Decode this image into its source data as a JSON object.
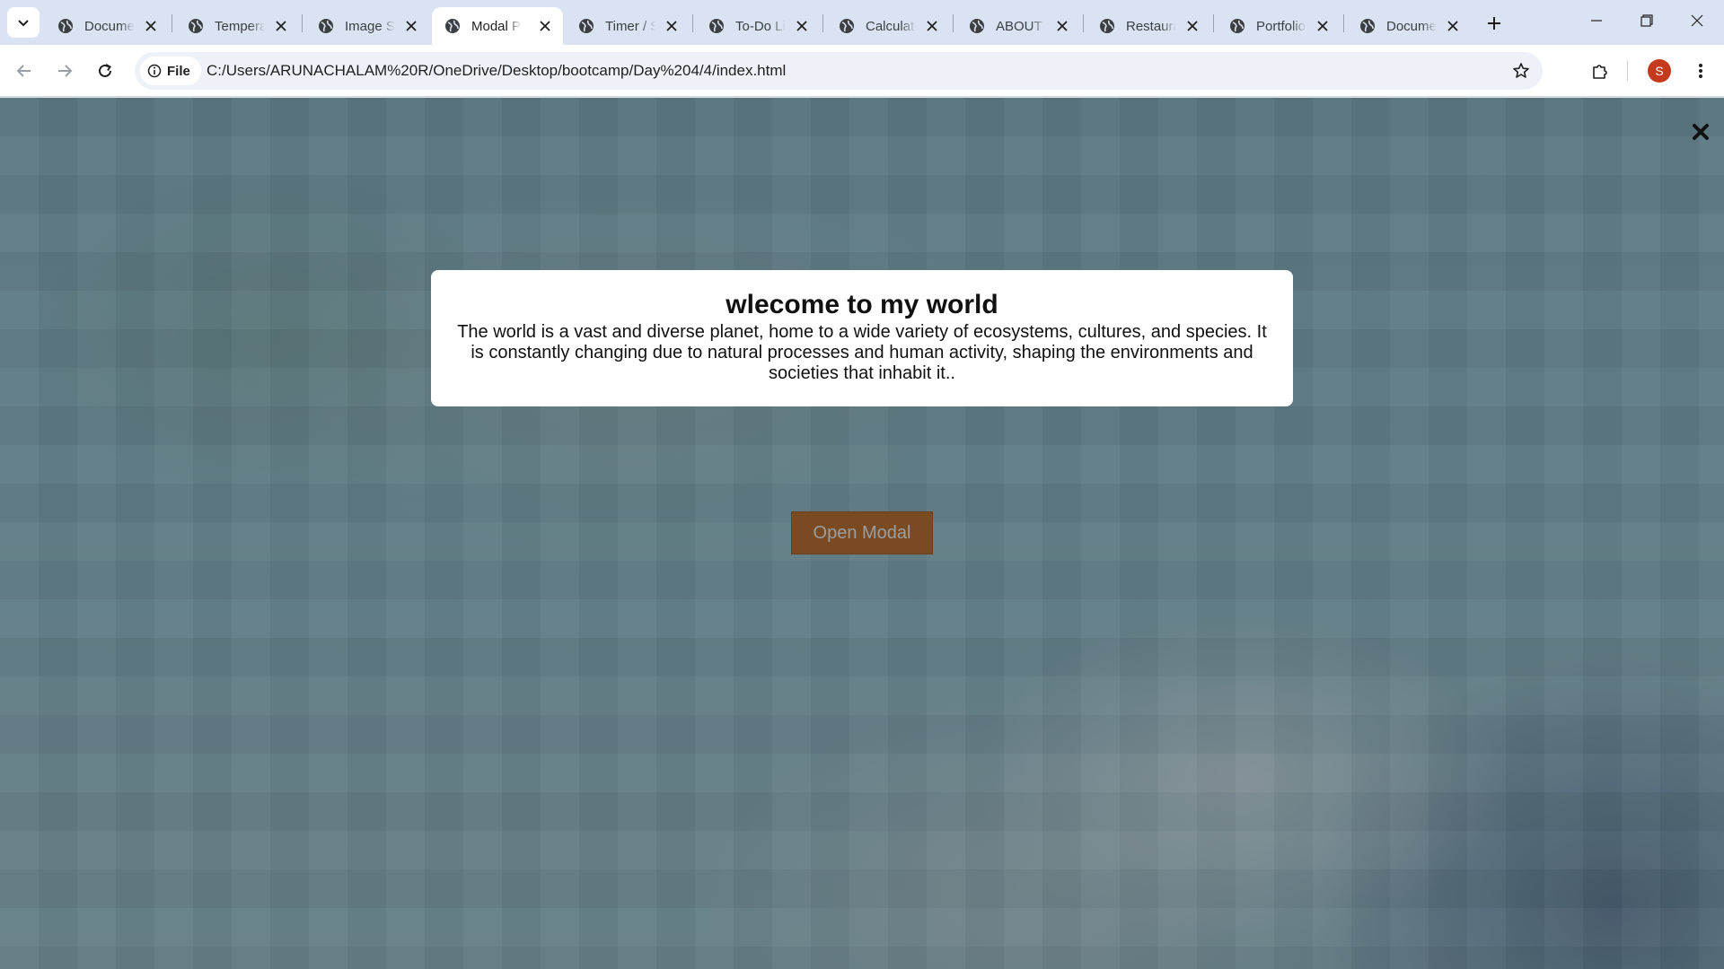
{
  "browser": {
    "tabs": [
      {
        "title": "Document"
      },
      {
        "title": "Temperature"
      },
      {
        "title": "Image Slider"
      },
      {
        "title": "Modal Popup",
        "active": true
      },
      {
        "title": "Timer / Stopwatch"
      },
      {
        "title": "To-Do List"
      },
      {
        "title": "Calculator"
      },
      {
        "title": "ABOUT ME"
      },
      {
        "title": "Restaurant"
      },
      {
        "title": "Portfolio"
      },
      {
        "title": "Document"
      }
    ],
    "site_chip_label": "File",
    "url": "C:/Users/ARUNACHALAM%20R/OneDrive/Desktop/bootcamp/Day%204/4/index.html",
    "profile_initial": "S",
    "profile_color": "#c5391d"
  },
  "page": {
    "modal": {
      "title": "wlecome to my world",
      "body": "The world is a vast and diverse planet, home to a wide variety of ecosystems, cultures, and species. It is constantly changing due to natural processes and human activity, shaping the environments and societies that inhabit it.."
    },
    "open_button_label": "Open Modal",
    "open_button_color": "#7a4a22"
  }
}
